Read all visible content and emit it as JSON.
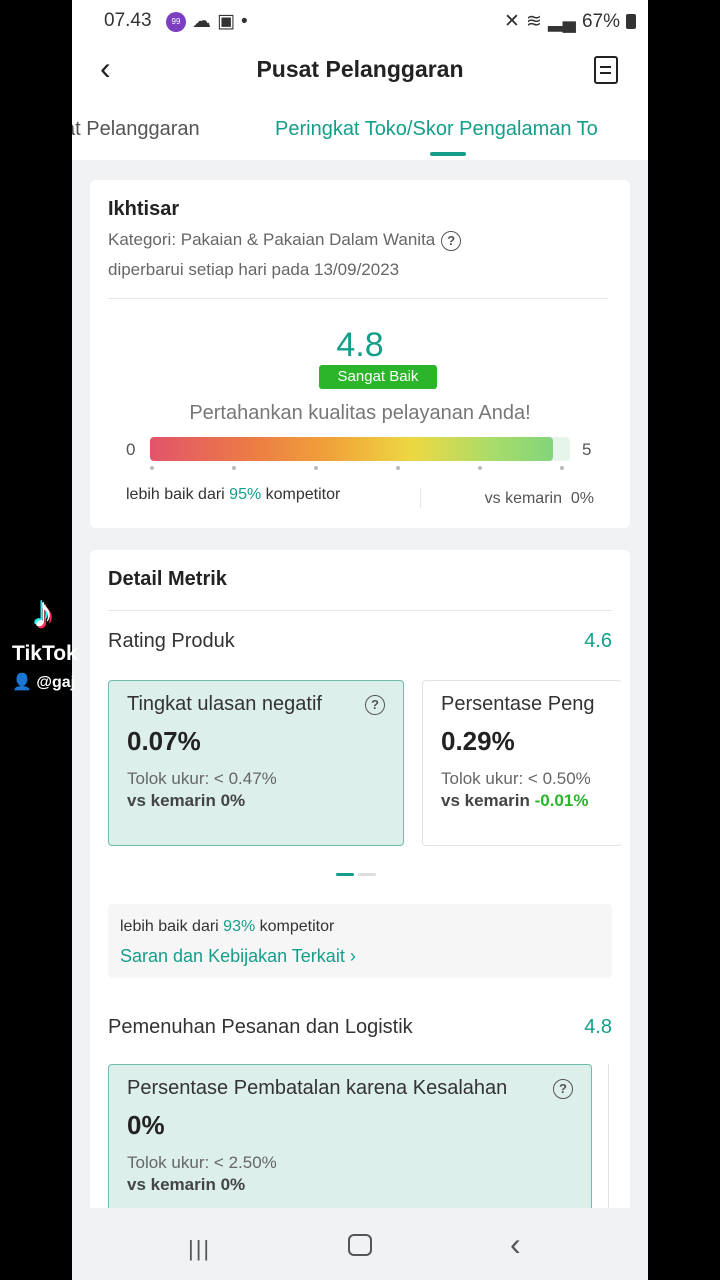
{
  "statusbar": {
    "time": "07.43",
    "battery": "67%",
    "badge": "99"
  },
  "header": {
    "title": "Pusat Pelanggaran"
  },
  "tabs": [
    {
      "label": "Poin Pelanggaran",
      "shown": "at Pelanggaran"
    },
    {
      "label": "Peringkat Toko/Skor Pengalaman To",
      "active": true
    }
  ],
  "overview": {
    "title": "Ikhtisar",
    "category": "Kategori: Pakaian & Pakaian Dalam Wanita",
    "updated": "diperbarui setiap hari pada 13/09/2023",
    "score": "4.8",
    "score_value": 4.8,
    "score_max": 5,
    "badge": "Sangat Baik",
    "motto": "Pertahankan kualitas pelayanan Anda!",
    "scale_min": "0",
    "scale_max": "5",
    "compare_prefix": "lebih baik dari ",
    "compare_percent": "95%",
    "compare_suffix": " kompetitor",
    "vs_yesterday": "vs kemarin  0%"
  },
  "detail": {
    "title": "Detail Metrik",
    "product_rating": {
      "label": "Rating Produk",
      "value": "4.6",
      "metrics": [
        {
          "name": "Tingkat ulasan negatif",
          "value": "0.07%",
          "benchmark": "Tolok ukur: < 0.47%",
          "vs_label": "vs kemarin",
          "vs_value": "0%"
        },
        {
          "name": "Persentase Peng",
          "value": "0.29%",
          "benchmark": "Tolok ukur: < 0.50%",
          "vs_label": "vs kemarin",
          "vs_value": "-0.01%"
        }
      ],
      "note": {
        "compare_prefix": "lebih baik dari ",
        "compare_percent": "93%",
        "compare_suffix": " kompetitor",
        "link": "Saran dan Kebijakan Terkait"
      }
    },
    "fulfillment": {
      "label": "Pemenuhan Pesanan dan Logistik",
      "value": "4.8",
      "metrics": [
        {
          "name": "Persentase Pembatalan karena Kesalahan",
          "value": "0%",
          "benchmark": "Tolok ukur: < 2.50%",
          "vs_label": "vs kemarin",
          "vs_value": "0%"
        }
      ]
    }
  },
  "overlay": {
    "brand": "TikTok",
    "user": "@gaj"
  },
  "colors": {
    "accent": "#149e8a",
    "good": "#2ab52a",
    "card_highlight": "#dcefeb"
  }
}
